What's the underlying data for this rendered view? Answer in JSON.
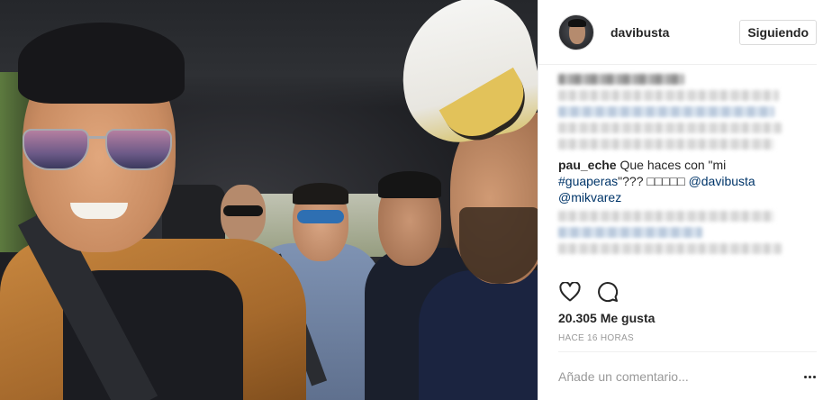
{
  "post": {
    "photo": {
      "alt_icon": "photo-selfie"
    },
    "header": {
      "username": "davibusta",
      "follow_label": "Siguiendo"
    },
    "comments": [
      {
        "user": "pau_eche",
        "text_before": " Que haces con \"mi ",
        "hashtag": "#guaperas",
        "text_after": "\"??? □□□□□ ",
        "mention1": "@davibusta",
        "mention2": "@mikvarez"
      }
    ],
    "actions": {
      "like_icon": "heart-icon",
      "comment_icon": "comment-icon"
    },
    "likes": "20.305 Me gusta",
    "time": "HACE 16 HORAS",
    "comment_box": {
      "placeholder": "Añade un comentario...",
      "more_icon": "more-options-icon"
    }
  }
}
